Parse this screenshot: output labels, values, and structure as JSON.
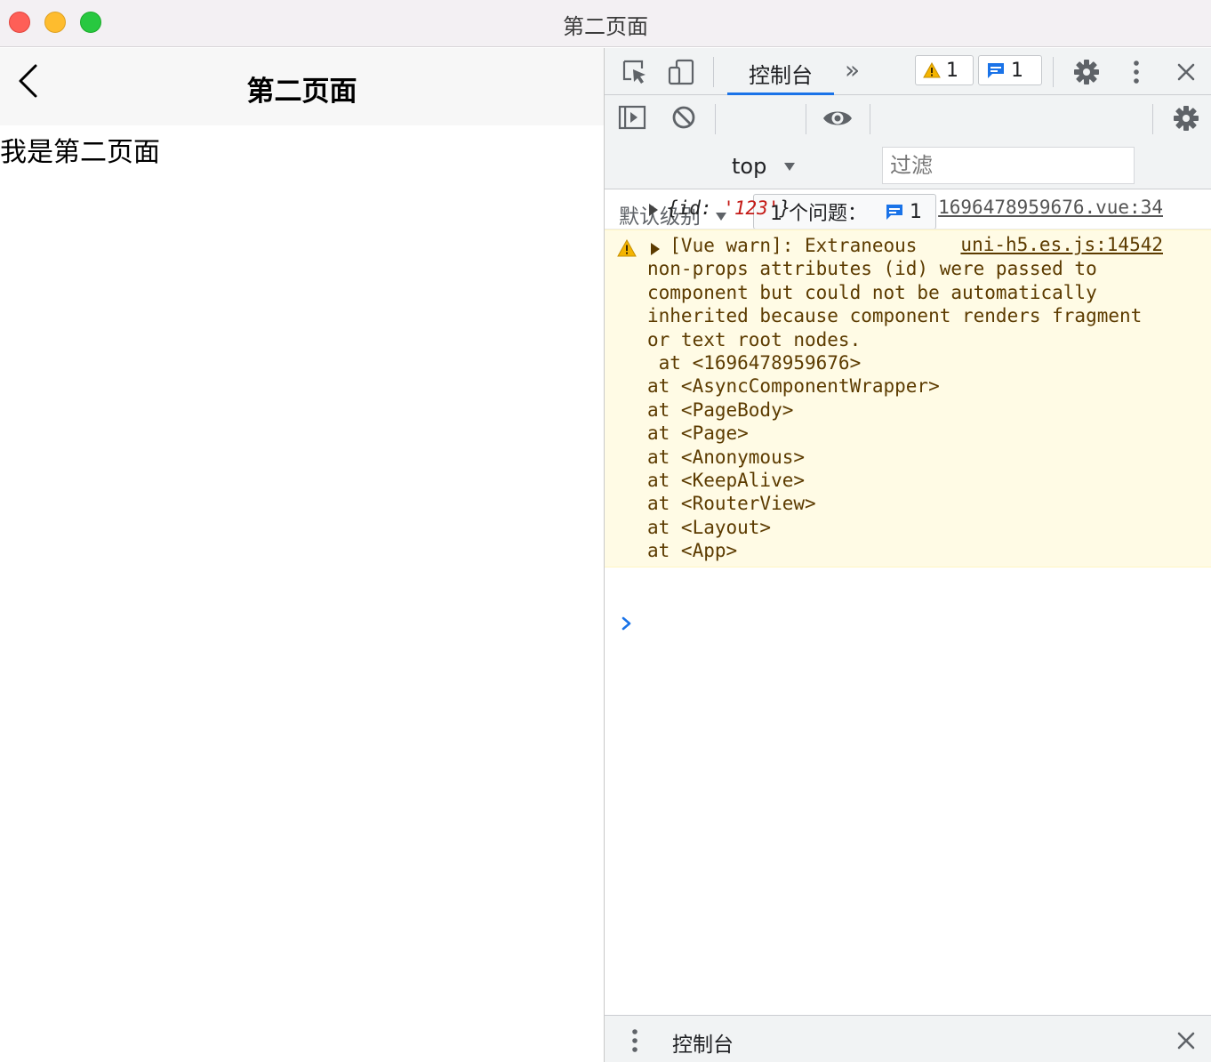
{
  "window": {
    "title": "第二页面"
  },
  "app": {
    "nav_title": "第二页面",
    "page_body": "我是第二页面"
  },
  "devtools": {
    "tabs": {
      "console": "控制台",
      "more": "»"
    },
    "badges": {
      "warnings": "1",
      "messages": "1"
    },
    "toolbar": {
      "context": "top",
      "filter_placeholder": "过滤",
      "level": "默认级别",
      "issues_label": "1 个问题：",
      "issues_count": "1"
    },
    "drawer": {
      "label": "控制台"
    }
  },
  "console": {
    "log": {
      "obj_open": "{",
      "key": "id:",
      "value": "'123'",
      "obj_close": "}",
      "source": "1696478959676.vue:34"
    },
    "warn": {
      "source": "uni-h5.es.js:14542",
      "message": "  [Vue warn]: Extraneous\nnon-props attributes (id) were passed to\ncomponent but could not be automatically\ninherited because component renders fragment\nor text root nodes.",
      "stack": [
        " at <1696478959676>",
        "at <AsyncComponentWrapper>",
        "at <PageBody>",
        "at <Page>",
        "at <Anonymous>",
        "at <KeepAlive>",
        "at <RouterView>",
        "at <Layout>",
        "at <App>"
      ]
    }
  },
  "colors": {
    "accent": "#1a73e8",
    "warn_bg": "#fffbe5",
    "warn_text": "#5c3b00",
    "string": "#c41a16",
    "close_light": "#fe5f57",
    "minimize_light": "#febc2e",
    "maximize_light": "#28c840"
  }
}
